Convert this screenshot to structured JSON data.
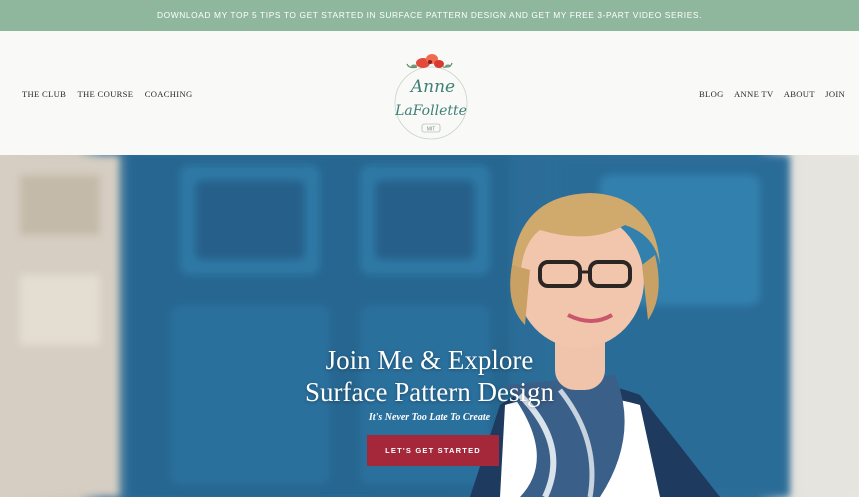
{
  "announcement": {
    "text": "DOWNLOAD MY TOP 5 TIPS TO GET STARTED IN SURFACE PATTERN DESIGN AND GET MY FREE 3-PART VIDEO SERIES."
  },
  "nav_left": [
    "THE CLUB",
    "THE COURSE",
    "COACHING"
  ],
  "nav_right": [
    "BLOG",
    "ANNE TV",
    "ABOUT",
    "JOIN"
  ],
  "logo": {
    "line1": "Anne",
    "line2": "LaFollette",
    "badge": "MIT"
  },
  "hero": {
    "title_line1": "Join Me & Explore",
    "title_line2": "Surface Pattern Design",
    "subtitle": "It's Never Too Late To Create",
    "cta_label": "LET'S GET STARTED"
  },
  "colors": {
    "announcement_bg": "#8fb79d",
    "cta_bg": "#a5283a",
    "hero_blue": "#2a6b96"
  }
}
